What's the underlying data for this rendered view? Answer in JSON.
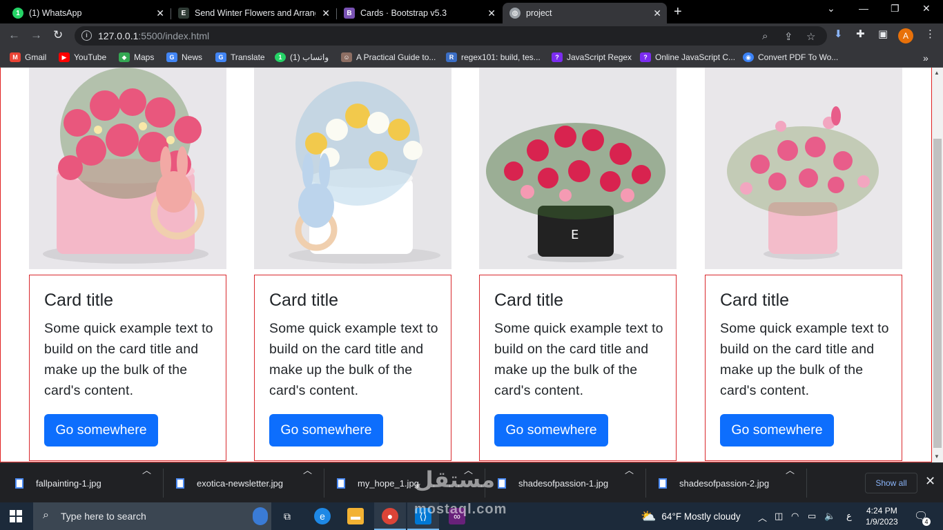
{
  "tabs": [
    {
      "title": "(1) WhatsApp",
      "icon": "whatsapp-icon",
      "color": "#25d366"
    },
    {
      "title": "Send Winter Flowers and Arrange",
      "icon": "exotica-icon",
      "color": "#2f3b35"
    },
    {
      "title": "Cards · Bootstrap v5.3",
      "icon": "bootstrap-icon",
      "color": "#7952b3"
    },
    {
      "title": "project",
      "icon": "globe-icon",
      "color": "#9aa0a6"
    }
  ],
  "address": {
    "host": "127.0.0.1",
    "rest": ":5500/index.html"
  },
  "profile_initial": "A",
  "bookmarks": [
    {
      "label": "Gmail",
      "icon": "gmail-icon",
      "color": "#ea4335",
      "glyph": "M"
    },
    {
      "label": "YouTube",
      "icon": "youtube-icon",
      "color": "#ff0000",
      "glyph": "▶"
    },
    {
      "label": "Maps",
      "icon": "maps-icon",
      "color": "#34a853",
      "glyph": "◆"
    },
    {
      "label": "News",
      "icon": "news-icon",
      "color": "#4285f4",
      "glyph": "G"
    },
    {
      "label": "Translate",
      "icon": "translate-icon",
      "color": "#4285f4",
      "glyph": "G"
    },
    {
      "label": "واتساب (1)",
      "icon": "whatsapp-icon",
      "color": "#25d366",
      "glyph": "1"
    },
    {
      "label": "A Practical Guide to...",
      "icon": "guide-icon",
      "color": "#8d6e63",
      "glyph": "☺"
    },
    {
      "label": "regex101: build, tes...",
      "icon": "regex101-icon",
      "color": "#3b6ec5",
      "glyph": "R"
    },
    {
      "label": "JavaScript Regex",
      "icon": "js-regex-icon",
      "color": "#7b2cf0",
      "glyph": "?"
    },
    {
      "label": "Online JavaScript C...",
      "icon": "js-compiler-icon",
      "color": "#7b2cf0",
      "glyph": "?"
    },
    {
      "label": "Convert PDF To Wo...",
      "icon": "pdf-convert-icon",
      "color": "#3b82f6",
      "glyph": "◉"
    }
  ],
  "cards": [
    {
      "title": "Card title",
      "text": "Some quick example text to build on the card title and make up the bulk of the card's content.",
      "button": "Go somewhere",
      "pot": "#f4b8c8",
      "flowers": "#e9577d"
    },
    {
      "title": "Card title",
      "text": "Some quick example text to build on the card title and make up the bulk of the card's content.",
      "button": "Go somewhere",
      "pot": "#ffffff",
      "flowers": "#f2c94c"
    },
    {
      "title": "Card title",
      "text": "Some quick example text to build on the card title and make up the bulk of the card's content.",
      "button": "Go somewhere",
      "pot": "#222222",
      "flowers": "#d8234f"
    },
    {
      "title": "Card title",
      "text": "Some quick example text to build on the card title and make up the bulk of the card's content.",
      "button": "Go somewhere",
      "pot": "#f3bcca",
      "flowers": "#e85d8a"
    }
  ],
  "downloads": [
    {
      "name": "fallpainting-1.jpg"
    },
    {
      "name": "exotica-newsletter.jpg"
    },
    {
      "name": "my_hope_1.jpg"
    },
    {
      "name": "shadesofpassion-1.jpg"
    },
    {
      "name": "shadesofpassion-2.jpg"
    }
  ],
  "downloads_show_all": "Show all",
  "taskbar": {
    "search_placeholder": "Type here to search",
    "weather": "64°F  Mostly cloudy",
    "time": "4:24 PM",
    "date": "1/9/2023",
    "notifications": "4",
    "lang": "ع"
  },
  "watermark": {
    "arabic": "مستقل",
    "latin": "mostaql.com"
  },
  "colors": {
    "button": "#0d6efd",
    "card_border": "#d9262a",
    "frame_border": "#e02020"
  }
}
